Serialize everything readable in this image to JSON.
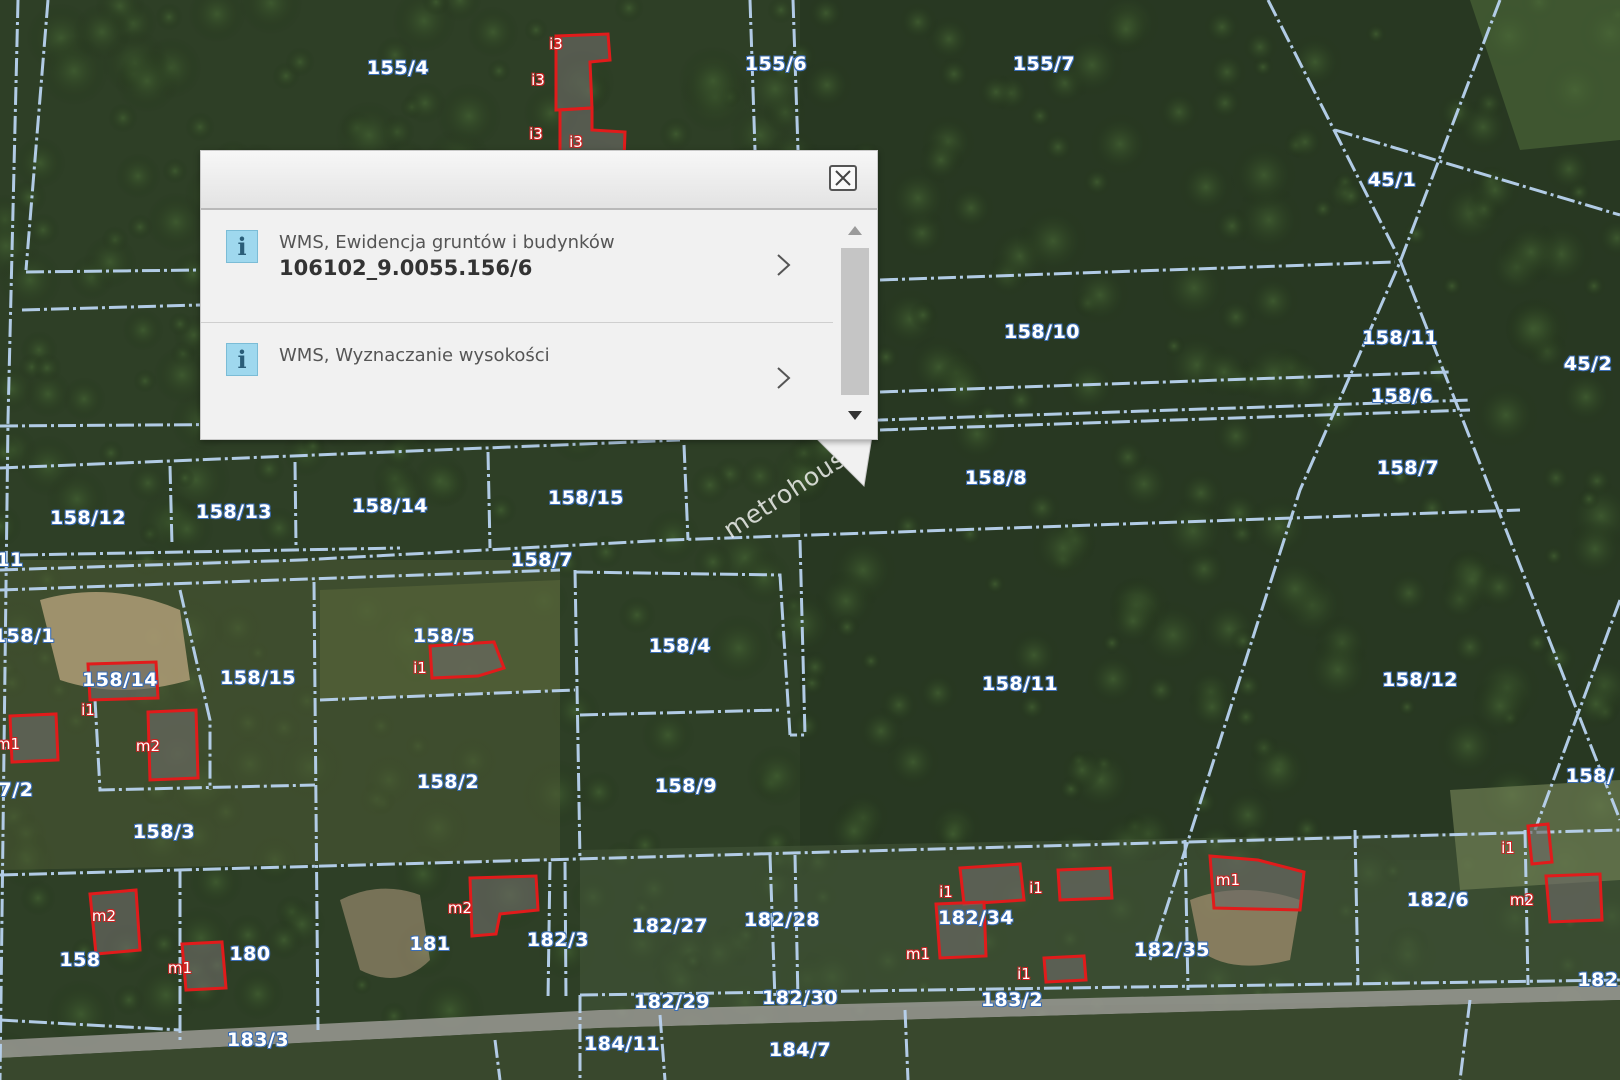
{
  "popup": {
    "items": [
      {
        "title": "WMS, Ewidencja gruntów i budynków",
        "value": "106102_9.0055.156/6"
      },
      {
        "title": "WMS, Wyznaczanie wysokości",
        "value": ""
      }
    ]
  },
  "watermark": "metrohouse",
  "colors": {
    "parcel_boundary": "#b9d3f0",
    "building_outline": "#e11b1b",
    "popup_bg": "#f1f1f1",
    "info_icon": "#9fd8ee"
  },
  "parcel_labels": [
    "155/4",
    "155/6",
    "155/7",
    "45/1",
    "45/2",
    "158/10",
    "158/11",
    "158/6",
    "158/7",
    "158/8",
    "158/12",
    "158/13",
    "158/14",
    "158/15",
    "158/7",
    "158/5",
    "158/4",
    "158/14",
    "158/15",
    "158/11",
    "158/12",
    "158/2",
    "158/3",
    "158/9",
    "158/",
    "158/1",
    "7/2",
    "11",
    "182/27",
    "182/28",
    "182/34",
    "182/35",
    "182/6",
    "182/3",
    "181",
    "180",
    "158",
    "182/29",
    "182/30",
    "183/2",
    "183/3",
    "184/11",
    "184/7",
    "182"
  ],
  "building_labels": [
    "i3",
    "i3",
    "i3",
    "i3",
    "i1",
    "i1",
    "m2",
    "m1",
    "m1",
    "m2",
    "m2",
    "m1",
    "i1",
    "i1",
    "m1",
    "i1",
    "i1",
    "m2"
  ]
}
